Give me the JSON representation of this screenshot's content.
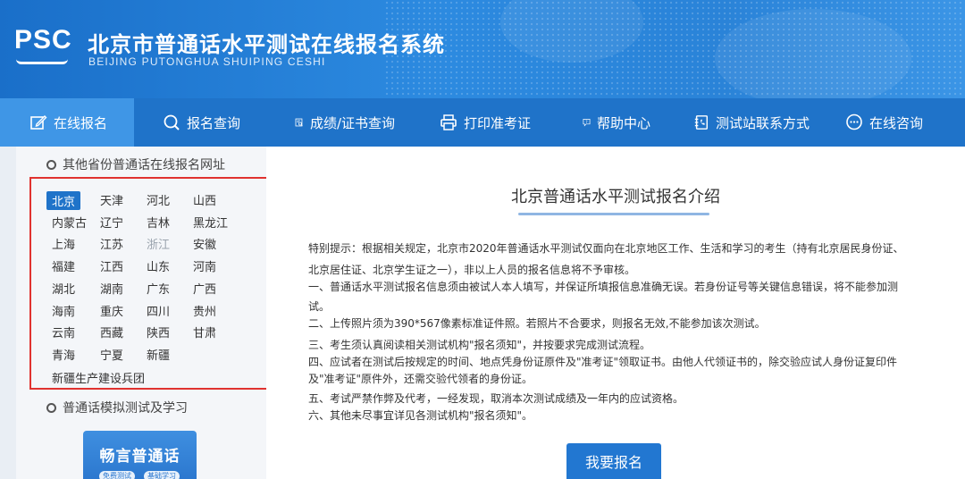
{
  "header": {
    "logo_text": "PSC",
    "title": "北京市普通话水平测试在线报名系统",
    "subtitle": "BEIJING PUTONGHUA SHUIPING CESHI"
  },
  "nav": [
    {
      "label": "在线报名",
      "icon": "edit-icon",
      "active": true
    },
    {
      "label": "报名查询",
      "icon": "search-icon"
    },
    {
      "label": "成绩/证书查询",
      "icon": "certificate-search-icon"
    },
    {
      "label": "打印准考证",
      "icon": "printer-icon"
    },
    {
      "label": "帮助中心",
      "icon": "help-icon"
    },
    {
      "label": "测试站联系方式",
      "icon": "phone-book-icon"
    },
    {
      "label": "在线咨询",
      "icon": "chat-icon"
    }
  ],
  "sidebar": {
    "other_provinces_heading": "其他省份普通话在线报名网址",
    "provinces": [
      "北京",
      "天津",
      "河北",
      "山西",
      "内蒙古",
      "辽宁",
      "吉林",
      "黑龙江",
      "上海",
      "江苏",
      "浙江",
      "安徽",
      "福建",
      "江西",
      "山东",
      "河南",
      "湖北",
      "湖南",
      "广东",
      "广西",
      "海南",
      "重庆",
      "四川",
      "贵州",
      "云南",
      "西藏",
      "陕西",
      "甘肃",
      "青海",
      "宁夏",
      "新疆",
      "新疆生产建设兵团"
    ],
    "active_province": "北京",
    "muted_province": "浙江",
    "mock_test_heading": "普通话模拟测试及学习",
    "banner": {
      "title": "畅言普通话",
      "pill_left": "免费测试",
      "pill_right": "基础学习"
    }
  },
  "main": {
    "title": "北京普通话水平测试报名介绍",
    "notice_lines": [
      "特别提示：根据相关规定，北京市2020年普通话水平测试仅面向在北京地区工作、生活和学习的考生（持有北京居民身份证、",
      "北京居住证、北京学生证之一），非以上人员的报名信息将不予审核。",
      "一、普通话水平测试报名信息须由被试人本人填写，并保证所填报信息准确无误。若身份证号等关键信息错误，将不能参加测",
      "试。",
      "二、上传照片须为390*567像素标准证件照。若照片不合要求，则报名无效,不能参加该次测试。",
      "三、考生须认真阅读相关测试机构\"报名须知\"，并按要求完成测试流程。",
      "四、应试者在测试后按规定的时间、地点凭身份证原件及\"准考证\"领取证书。由他人代领证书的，除交验应试人身份证复印件",
      "及\"准考证\"原件外，还需交验代领者的身份证。",
      "五、考试严禁作弊及代考，一经发现，取消本次测试成绩及一年内的应试资格。",
      "六、其他未尽事宜详见各测试机构\"报名须知\"。"
    ],
    "apply_button": "我要报名"
  }
}
